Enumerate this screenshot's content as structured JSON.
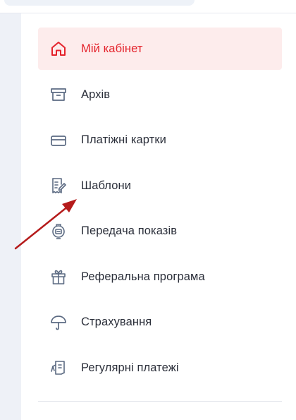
{
  "menu": {
    "items": [
      {
        "label": "Мій кабінет",
        "icon": "home-icon",
        "active": true
      },
      {
        "label": "Архів",
        "icon": "archive-icon",
        "active": false
      },
      {
        "label": "Платіжні картки",
        "icon": "credit-card-icon",
        "active": false
      },
      {
        "label": "Шаблони",
        "icon": "template-document-icon",
        "active": false
      },
      {
        "label": "Передача показів",
        "icon": "meter-icon",
        "active": false
      },
      {
        "label": "Реферальна програма",
        "icon": "gift-icon",
        "active": false
      },
      {
        "label": "Страхування",
        "icon": "umbrella-icon",
        "active": false
      },
      {
        "label": "Регулярні платежі",
        "icon": "recurring-payment-icon",
        "active": false
      }
    ]
  },
  "colors": {
    "accent": "#e4222b",
    "active_background": "#fdecec",
    "icon": "#5b6a82",
    "text": "#2b2f3a",
    "annotation_arrow": "#b51b1b"
  }
}
